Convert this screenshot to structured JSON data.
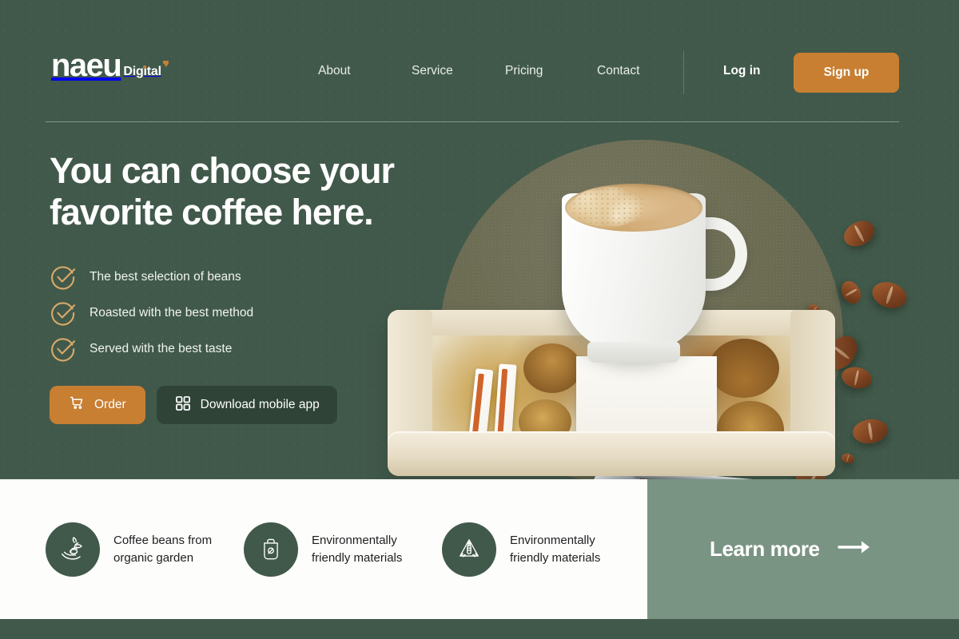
{
  "header": {
    "logo": {
      "mark": "naeu",
      "sub": "Digital"
    },
    "nav": [
      {
        "label": "About"
      },
      {
        "label": "Service"
      },
      {
        "label": "Pricing"
      },
      {
        "label": "Contact"
      }
    ],
    "login_label": "Log in",
    "signup_label": "Sign up"
  },
  "hero": {
    "headline": "You can choose your favorite coffee here.",
    "features": [
      {
        "label": "The best selection of beans",
        "icon": "check-circle-icon"
      },
      {
        "label": "Roasted with the best method",
        "icon": "check-circle-icon"
      },
      {
        "label": "Served with the best taste",
        "icon": "check-circle-icon"
      }
    ],
    "buttons": {
      "order": {
        "label": "Order",
        "icon": "shopping-cart-icon"
      },
      "download": {
        "label": "Download mobile app",
        "icon": "grid-squares-icon"
      }
    }
  },
  "benefits": [
    {
      "line1": "Coffee beans from",
      "line2": "organic garden",
      "icon": "hand-sprout-icon"
    },
    {
      "line1": "Environmentally",
      "line2": "friendly materials",
      "icon": "eco-bag-icon"
    },
    {
      "line1": "Environmentally",
      "line2": "friendly materials",
      "icon": "recycle-bottle-icon"
    }
  ],
  "learn_more": {
    "label": "Learn more",
    "icon": "arrow-right-icon"
  },
  "colors": {
    "dark_green": "#41594A",
    "sage_green": "#7A9483",
    "orange": "#C87F32",
    "tan": "#D9A969",
    "panel_white": "#FDFDFC",
    "olive_arch": "#6C6C53",
    "button_dark": "#2F4437"
  }
}
